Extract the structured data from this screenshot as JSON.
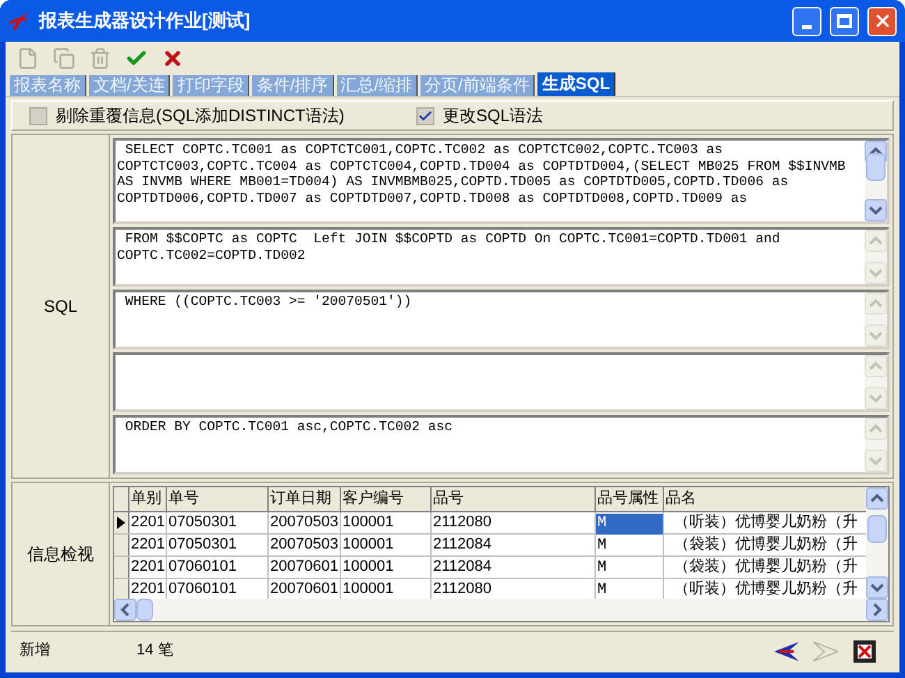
{
  "window": {
    "title": "报表生成器设计作业[测试]"
  },
  "toolbar": [
    {
      "kind": "new",
      "disabled": true
    },
    {
      "kind": "copy",
      "disabled": true
    },
    {
      "kind": "delete",
      "disabled": true
    },
    {
      "kind": "confirm",
      "disabled": false
    },
    {
      "kind": "cancel",
      "disabled": false
    }
  ],
  "tabs": [
    {
      "label": "报表名称",
      "selected": false
    },
    {
      "label": "文档/关连",
      "selected": false
    },
    {
      "label": "打印字段",
      "selected": false
    },
    {
      "label": "条件/排序",
      "selected": false
    },
    {
      "label": "汇总/缩排",
      "selected": false
    },
    {
      "label": "分页/前端条件",
      "selected": false
    },
    {
      "label": "生成SQL",
      "selected": true
    }
  ],
  "options": [
    {
      "label": "剔除重覆信息(SQL添加DISTINCT语法)",
      "checked": false
    },
    {
      "label": "更改SQL语法",
      "checked": true
    }
  ],
  "sql": {
    "label": "SQL",
    "boxes": [
      {
        "kind": "text",
        "text": " SELECT COPTC.TC001 as COPTCTC001,COPTC.TC002 as COPTCTC002,COPTC.TC003 as COPTCTC003,COPTC.TC004 as COPTCTC004,COPTD.TD004 as COPTDTD004,(SELECT MB025 FROM $$INVMB AS INVMB WHERE MB001=TD004) AS INVMBMB025,COPTD.TD005 as COPTDTD005,COPTD.TD006 as COPTDTD006,COPTD.TD007 as COPTDTD007,COPTD.TD008 as COPTDTD008,COPTD.TD009 as"
      },
      {
        "kind": "text",
        "text": " FROM $$COPTC as COPTC  Left JOIN $$COPTD as COPTD On COPTC.TC001=COPTD.TD001 and COPTC.TC002=COPTD.TD002"
      },
      {
        "kind": "text",
        "text": " WHERE ((COPTC.TC003 >= '20070501'))"
      },
      {
        "kind": "empty"
      },
      {
        "kind": "text",
        "text": " ORDER BY COPTC.TC001 asc,COPTC.TC002 asc"
      }
    ]
  },
  "preview": {
    "label": "信息检视",
    "columns": [
      "单别",
      "单号",
      "订单日期",
      "客户编号",
      "品号",
      "品号属性",
      "品名"
    ],
    "rows": [
      {
        "selected": true,
        "cells": [
          "2201",
          "07050301",
          "20070503",
          "100001",
          "2112080",
          "M",
          "（听装）优博婴儿奶粉（升"
        ]
      },
      {
        "selected": false,
        "cells": [
          "2201",
          "07050301",
          "20070503",
          "100001",
          "2112084",
          "M",
          "（袋装）优博婴儿奶粉（升"
        ]
      },
      {
        "selected": false,
        "cells": [
          "2201",
          "07060101",
          "20070601",
          "100001",
          "2112084",
          "M",
          "（袋装）优博婴儿奶粉（升"
        ]
      },
      {
        "selected": false,
        "cells": [
          "2201",
          "07060101",
          "20070601",
          "100001",
          "2112080",
          "M",
          "（听装）优博婴儿奶粉（升"
        ]
      }
    ]
  },
  "status_bar": {
    "mode": "新增",
    "count": "14 笔"
  }
}
